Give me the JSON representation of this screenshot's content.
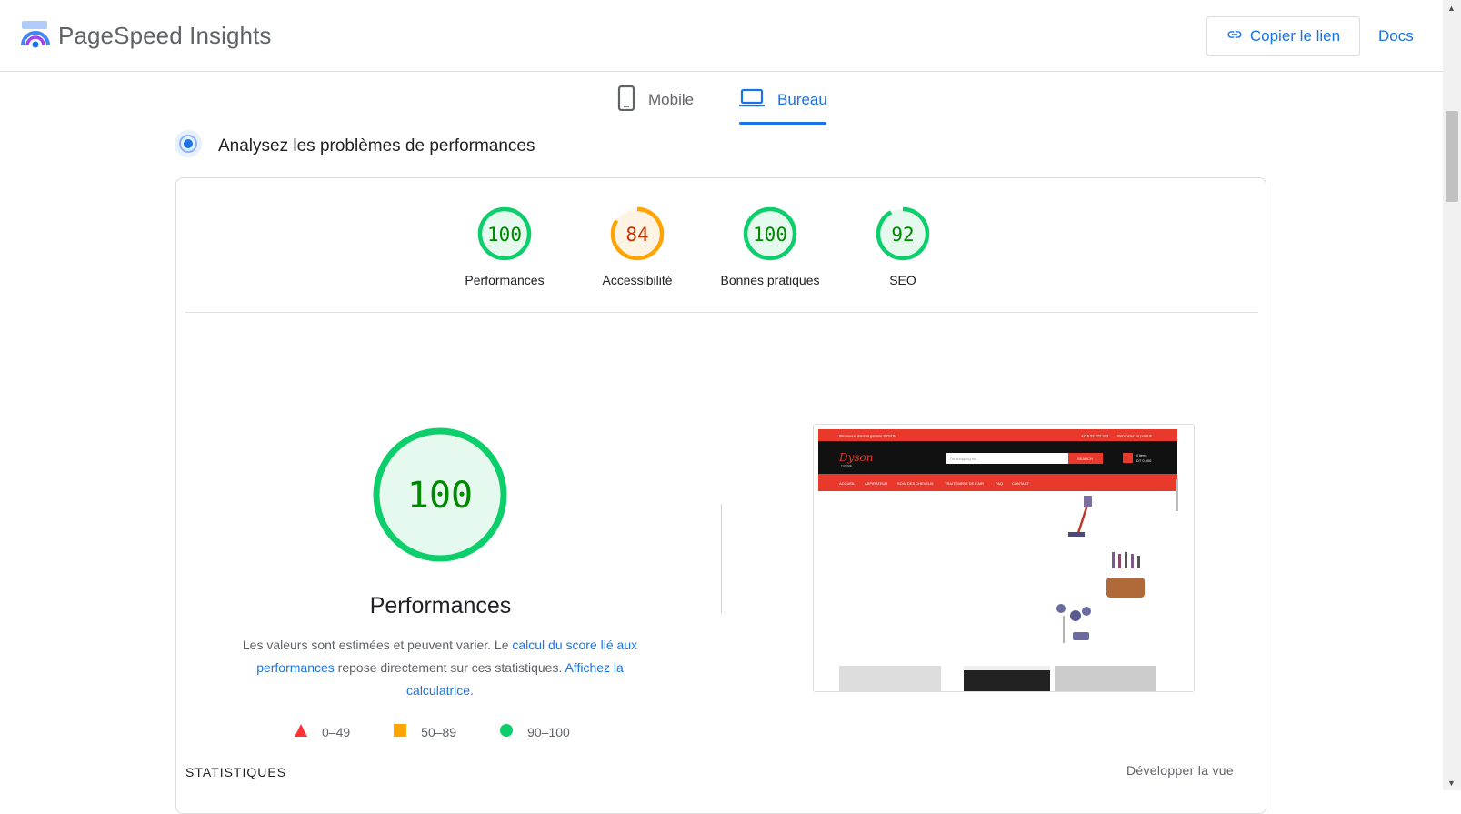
{
  "header": {
    "app_title": "PageSpeed Insights",
    "copy_link_label": "Copier le lien",
    "docs_label": "Docs"
  },
  "tabs": {
    "mobile_label": "Mobile",
    "desktop_label": "Bureau",
    "active": "desktop"
  },
  "section": {
    "title": "Analysez les problèmes de performances"
  },
  "scores": [
    {
      "label": "Performances",
      "value": "100",
      "color": "#0cce6b",
      "text_color": "#008800",
      "fill": "#e6f9ef"
    },
    {
      "label": "Accessibilité",
      "value": "84",
      "color": "#ffa400",
      "text_color": "#c33300",
      "fill": "#fff4e4"
    },
    {
      "label": "Bonnes pratiques",
      "value": "100",
      "color": "#0cce6b",
      "text_color": "#008800",
      "fill": "#e6f9ef"
    },
    {
      "label": "SEO",
      "value": "92",
      "color": "#0cce6b",
      "text_color": "#008800",
      "fill": "#e6f9ef"
    }
  ],
  "main_score": {
    "value": "100",
    "label": "Performances",
    "desc_1": "Les valeurs sont estimées et peuvent varier. Le ",
    "desc_link_1": "calcul du score lié aux performances",
    "desc_2": " repose directement sur ces statistiques. ",
    "desc_link_2": "Affichez la calculatrice."
  },
  "legend": [
    {
      "range": "0–49",
      "shape": "triangle",
      "color": "#ff3333"
    },
    {
      "range": "50–89",
      "shape": "square",
      "color": "#ffa400"
    },
    {
      "range": "90–100",
      "shape": "circle",
      "color": "#0cce6b"
    }
  ],
  "preview": {
    "brand": "Dyson",
    "brand_sub": "TUNISIE",
    "search_placeholder": "I'm shopping for...",
    "search_button": "SEARCH",
    "cart_text": "0 Items",
    "cart_total": "DT 0,000",
    "top_left": "Bienvenue dans la gamme DYSON",
    "top_right_1": "+216 52 222 333",
    "top_right_2": "Récupérer un produit",
    "nav": [
      "ACCUEIL",
      "ASPIRATEUR",
      "SOIN DES CHEVEUX",
      "TRAITEMENT DE L'AIR",
      "FAQ",
      "CONTACT"
    ]
  },
  "stats": {
    "title": "STATISTIQUES",
    "expand_label": "Développer la vue"
  },
  "colors": {
    "accent": "#1a73e8",
    "pass": "#0cce6b",
    "average": "#ffa400",
    "fail": "#ff3333"
  }
}
